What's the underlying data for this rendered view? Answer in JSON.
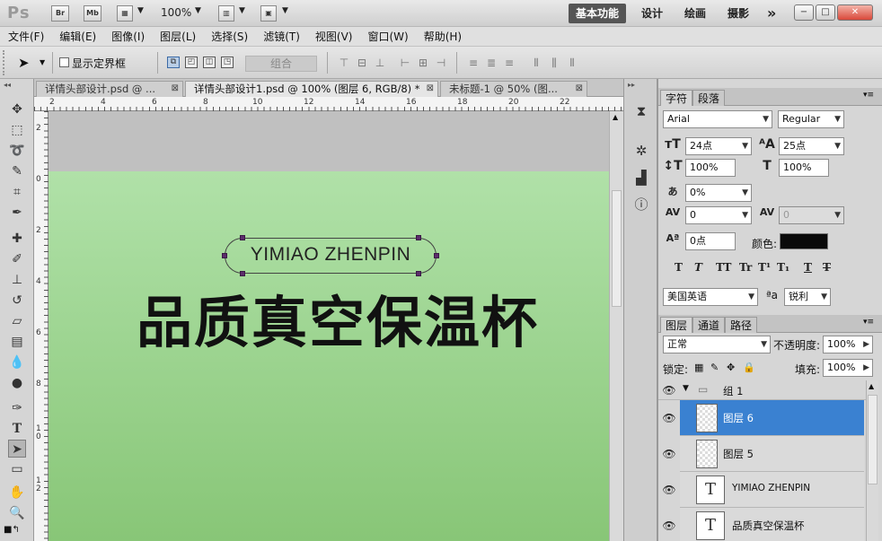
{
  "app": {
    "logo": "Ps",
    "bridge": "Br",
    "minibridge": "Mb",
    "zoom": "100%",
    "workspaces": [
      "基本功能",
      "设计",
      "绘画",
      "摄影"
    ],
    "more": "»",
    "window_controls": [
      "−",
      "□",
      "✕"
    ]
  },
  "menu": [
    "文件(F)",
    "编辑(E)",
    "图像(I)",
    "图层(L)",
    "选择(S)",
    "滤镜(T)",
    "视图(V)",
    "窗口(W)",
    "帮助(H)"
  ],
  "options": {
    "show_bounding_box": "显示定界框",
    "combine": "组合"
  },
  "tabs": [
    {
      "label": "详情头部设计.psd @ ..."
    },
    {
      "label": "详情头部设计1.psd @ 100% (图层 6, RGB/8) *"
    },
    {
      "label": "未标题-1 @ 50% (图..."
    }
  ],
  "ruler": {
    "top": [
      "2",
      "4",
      "6",
      "8",
      "10",
      "12",
      "14",
      "16",
      "18",
      "20",
      "22"
    ],
    "left": [
      "2",
      "0",
      "2",
      "4",
      "6",
      "8",
      "1\n0",
      "1\n2"
    ]
  },
  "canvas": {
    "subtitle": "YIMIAO ZHENPIN",
    "headline": "品质真空保温杯",
    "bg_top": "#b0e1a8",
    "bg_bottom": "#88c677"
  },
  "character": {
    "tabs": [
      "字符",
      "段落"
    ],
    "font_family": "Arial",
    "font_style": "Regular",
    "font_size": "24点",
    "leading": "25点",
    "vertical_scale": "100%",
    "horizontal_scale": "100%",
    "tsume": "0%",
    "kerning": "0",
    "tracking": "0",
    "baseline_shift": "0点",
    "color_label": "颜色:",
    "color": "#0a0a0a",
    "style_buttons": [
      "T",
      "T",
      "TT",
      "Tr",
      "T¹",
      "T₁",
      "T",
      "T"
    ],
    "language": "美国英语",
    "antialias_label": "ªa",
    "antialias": "锐利"
  },
  "layers": {
    "tabs": [
      "图层",
      "通道",
      "路径"
    ],
    "blend_mode": "正常",
    "opacity_label": "不透明度:",
    "opacity": "100%",
    "lock_label": "锁定:",
    "fill_label": "填充:",
    "fill": "100%",
    "group": "组 1",
    "items": [
      {
        "name": "图层 6",
        "selected": true
      },
      {
        "name": "图层 5",
        "selected": false
      },
      {
        "name": "YIMIAO ZHENPIN",
        "selected": false
      },
      {
        "name": "品质真空保温杯",
        "selected": false
      }
    ]
  }
}
